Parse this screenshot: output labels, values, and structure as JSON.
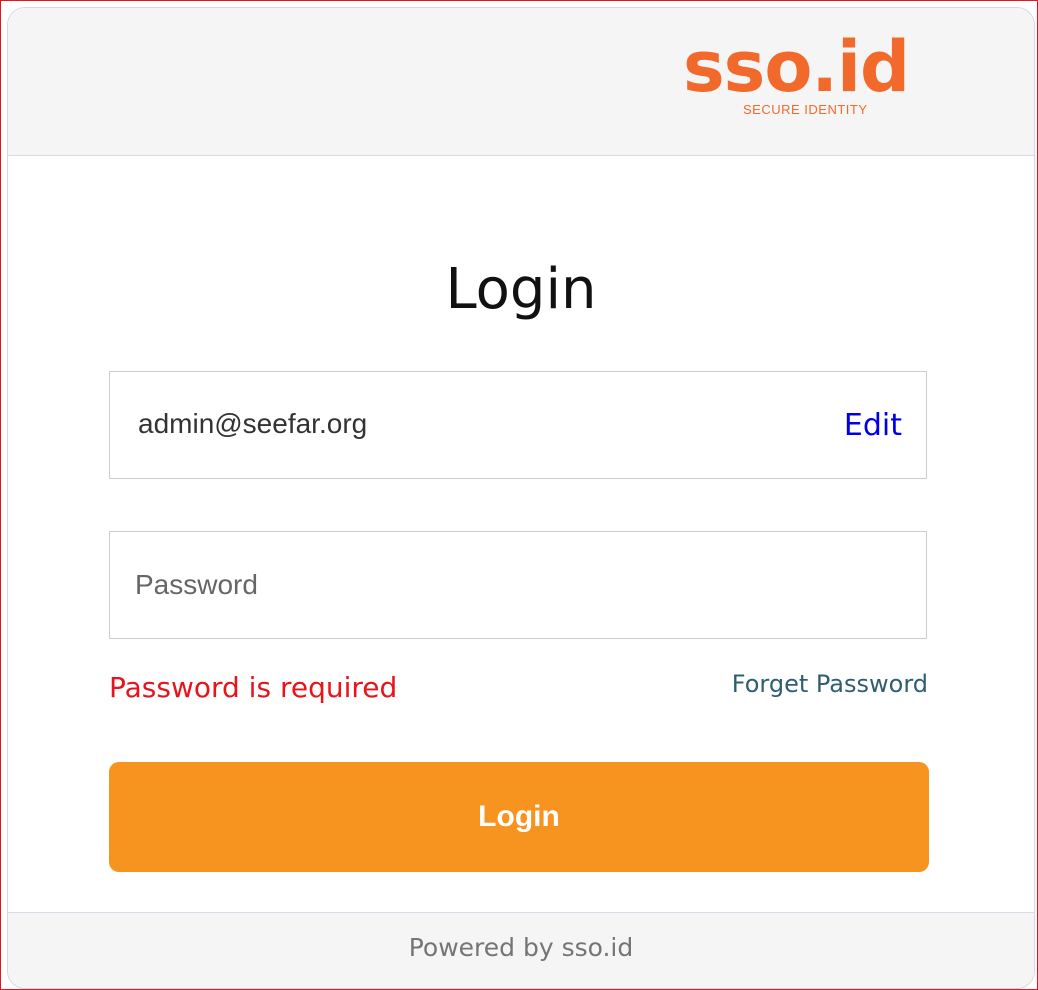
{
  "logo": {
    "wordmark": "sso.id",
    "tagline": "SECURE IDENTITY",
    "color": "#f26a2b"
  },
  "form": {
    "title": "Login",
    "email_value": "admin@seefar.org",
    "edit_label": "Edit",
    "password_placeholder": "Password",
    "password_value": "",
    "error_message": "Password is required",
    "forget_password_label": "Forget Password",
    "submit_label": "Login"
  },
  "footer": {
    "text": "Powered by sso.id"
  },
  "colors": {
    "accent_button": "#f7941f",
    "error": "#e8141c",
    "link_edit": "#0000e6",
    "link_forget": "#2f5f6f"
  }
}
